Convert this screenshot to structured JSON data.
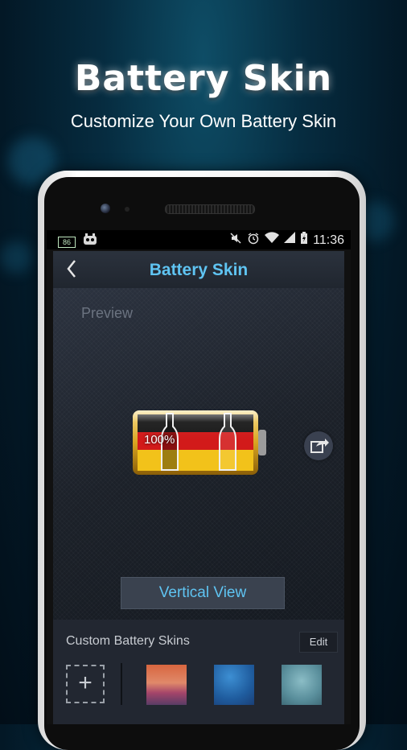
{
  "promo": {
    "headline": "Battery Skin",
    "subheadline": "Customize Your Own Battery Skin"
  },
  "statusbar": {
    "battery_indicator": "86",
    "time": "11:36"
  },
  "appbar": {
    "title": "Battery Skin",
    "back_icon": "chevron-left-icon"
  },
  "preview": {
    "label": "Preview",
    "battery_percent": "100%",
    "skin_theme": "germany-flag",
    "share_icon": "share-icon",
    "vertical_view_label": "Vertical View"
  },
  "custom_skins": {
    "title": "Custom Battery Skins",
    "edit_label": "Edit",
    "add_icon": "plus-icon",
    "thumbnails": [
      {
        "name": "sunset"
      },
      {
        "name": "blue"
      },
      {
        "name": "teal"
      }
    ]
  },
  "colors": {
    "accent": "#5fc4f2",
    "background": "#031826"
  }
}
